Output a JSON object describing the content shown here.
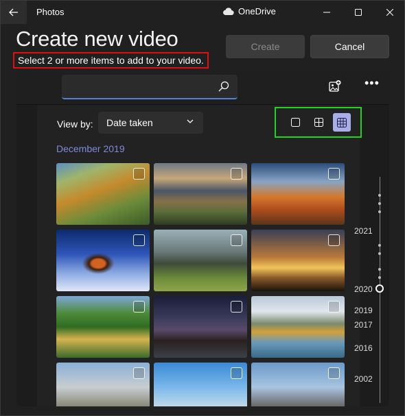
{
  "titlebar": {
    "app_name": "Photos",
    "cloud_label": "OneDrive"
  },
  "header": {
    "title": "Create new video",
    "subtitle": "Select 2 or more items to add to your video.",
    "create_label": "Create",
    "cancel_label": "Cancel"
  },
  "search": {
    "value": "",
    "placeholder": ""
  },
  "view": {
    "label": "View by:",
    "selected": "Date taken",
    "size_options": [
      "small",
      "medium",
      "large"
    ],
    "active_size": "large"
  },
  "section": {
    "label": "December 2019"
  },
  "photos": [
    {
      "name": "autumn-mountain-valley"
    },
    {
      "name": "sunset-lake-valley"
    },
    {
      "name": "autumn-lake-mountain"
    },
    {
      "name": "snowy-cabin-night"
    },
    {
      "name": "rocky-pinnacles"
    },
    {
      "name": "radio-telescopes-sunset"
    },
    {
      "name": "green-canyon-gorge"
    },
    {
      "name": "milky-way-night-sky"
    },
    {
      "name": "alpine-lake-island"
    },
    {
      "name": "yosemite-valley"
    },
    {
      "name": "tipi-tents"
    },
    {
      "name": "mountain-wolf"
    }
  ],
  "timeline": {
    "years": [
      "2021",
      "2020",
      "2019",
      "2017",
      "2016",
      "2002"
    ],
    "current": "2020"
  },
  "colors": {
    "accent": "#4d86d6",
    "highlight_red": "#e01010",
    "highlight_green": "#1ed61e",
    "section_label": "#7f8bd8"
  }
}
